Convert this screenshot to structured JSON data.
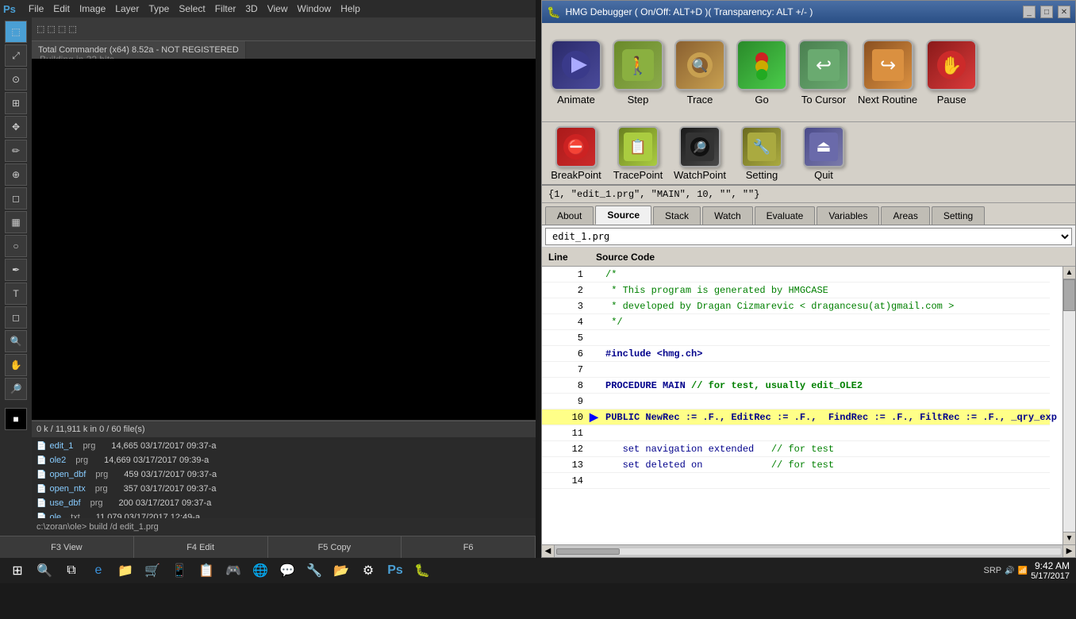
{
  "photoshop": {
    "menu_items": [
      "Ps",
      "File",
      "Edit",
      "Image",
      "Layer",
      "Type",
      "Select",
      "Filter",
      "3D",
      "View",
      "Window",
      "Help"
    ],
    "tab_title": "Total Commander (x64) 8.52a - NOT REGISTERED",
    "build_msg": "Building in 32 bits...",
    "cmd_path": "c:\\zoran\\ole> build /d edit_1.prg",
    "status_bar": "0 k / 11,911 k in 0 / 60 file(s)",
    "fn_keys": [
      "F3 View",
      "F4 Edit",
      "F5 Copy",
      "F6"
    ],
    "files": [
      {
        "name": "edit_1",
        "ext": "prg",
        "size": "14,665",
        "date": "03/17/2017",
        "time": "09:37-a"
      },
      {
        "name": "ole2",
        "ext": "prg",
        "size": "14,669",
        "date": "03/17/2017",
        "time": "09:39-a"
      },
      {
        "name": "open_dbf",
        "ext": "prg",
        "size": "459",
        "date": "03/17/2017",
        "time": "09:37-a"
      },
      {
        "name": "open_ntx",
        "ext": "prg",
        "size": "357",
        "date": "03/17/2017",
        "time": "09:37-a"
      },
      {
        "name": "use_dbf",
        "ext": "prg",
        "size": "200",
        "date": "03/17/2017",
        "time": "09:37-a"
      },
      {
        "name": "ole",
        "ext": "txt",
        "size": "11,079",
        "date": "03/17/2017",
        "time": "12:49-a"
      }
    ]
  },
  "debugger": {
    "title": "HMG Debugger   ( On/Off: ALT+D )( Transparency: ALT +/- )",
    "toolbar1": {
      "buttons": [
        {
          "id": "animate",
          "label": "Animate",
          "icon": "▶▶",
          "icon_class": "icon-animate"
        },
        {
          "id": "step",
          "label": "Step",
          "icon": "🚶",
          "icon_class": "icon-step"
        },
        {
          "id": "trace",
          "label": "Trace",
          "icon": "🔍",
          "icon_class": "icon-trace"
        },
        {
          "id": "go",
          "label": "Go",
          "icon": "🚦",
          "icon_class": "icon-go"
        },
        {
          "id": "tocursor",
          "label": "To Cursor",
          "icon": "↩",
          "icon_class": "icon-tocursor"
        },
        {
          "id": "nextroutine",
          "label": "Next Routine",
          "icon": "↪",
          "icon_class": "icon-nextroutine"
        },
        {
          "id": "pause",
          "label": "Pause",
          "icon": "✋",
          "icon_class": "icon-pause"
        }
      ]
    },
    "toolbar2": {
      "buttons": [
        {
          "id": "breakpoint",
          "label": "BreakPoint",
          "icon": "🛑",
          "icon_class": "icon-breakpoint"
        },
        {
          "id": "tracepoint",
          "label": "TracePoint",
          "icon": "📋",
          "icon_class": "icon-tracepoint"
        },
        {
          "id": "watchpoint",
          "label": "WatchPoint",
          "icon": "🔎",
          "icon_class": "icon-watchpoint"
        },
        {
          "id": "setting",
          "label": "Setting",
          "icon": "🔧",
          "icon_class": "icon-setting"
        },
        {
          "id": "quit",
          "label": "Quit",
          "icon": "⏏",
          "icon_class": "icon-quit"
        }
      ]
    },
    "status_text": "{1, \"edit_1.prg\", \"MAIN\", 10, \"\", \"\"}",
    "tabs": [
      "About",
      "Source",
      "Stack",
      "Watch",
      "Evaluate",
      "Variables",
      "Areas",
      "Setting"
    ],
    "active_tab": "Source",
    "file_select": "edit_1.prg",
    "columns": {
      "line": "Line",
      "source": "Source Code"
    },
    "code_lines": [
      {
        "num": 1,
        "code": "/*",
        "type": "comment",
        "current": false
      },
      {
        "num": 2,
        "code": " * This program is generated by HMGCASE",
        "type": "comment",
        "current": false
      },
      {
        "num": 3,
        "code": " * developed by Dragan Cizmarevic < dragancesu(at)gmail.com >",
        "type": "comment",
        "current": false
      },
      {
        "num": 4,
        "code": " */",
        "type": "comment",
        "current": false
      },
      {
        "num": 5,
        "code": "",
        "type": "empty",
        "current": false
      },
      {
        "num": 6,
        "code": "#include <hmg.ch>",
        "type": "include",
        "current": false
      },
      {
        "num": 7,
        "code": "",
        "type": "empty",
        "current": false
      },
      {
        "num": 8,
        "code": "PROCEDURE MAIN // for test, usually edit_OLE2",
        "type": "keyword",
        "current": false
      },
      {
        "num": 9,
        "code": "",
        "type": "empty",
        "current": false
      },
      {
        "num": 10,
        "code": "PUBLIC NewRec := .F., EditRec := .F.,  FindRec := .F., FiltRec := .F., _qry_exp := \"",
        "type": "keyword",
        "current": true
      },
      {
        "num": 11,
        "code": "",
        "type": "empty",
        "current": false
      },
      {
        "num": 12,
        "code": "   set navigation extended   // for test",
        "type": "mixed",
        "current": false
      },
      {
        "num": 13,
        "code": "   set deleted on            // for test",
        "type": "mixed",
        "current": false
      },
      {
        "num": 14,
        "code": "",
        "type": "empty",
        "current": false
      }
    ]
  },
  "taskbar": {
    "time": "9:42 AM",
    "date": "5/17/2017",
    "start_label": "⊞",
    "search_label": "🔍",
    "layout_label": "SRP"
  }
}
